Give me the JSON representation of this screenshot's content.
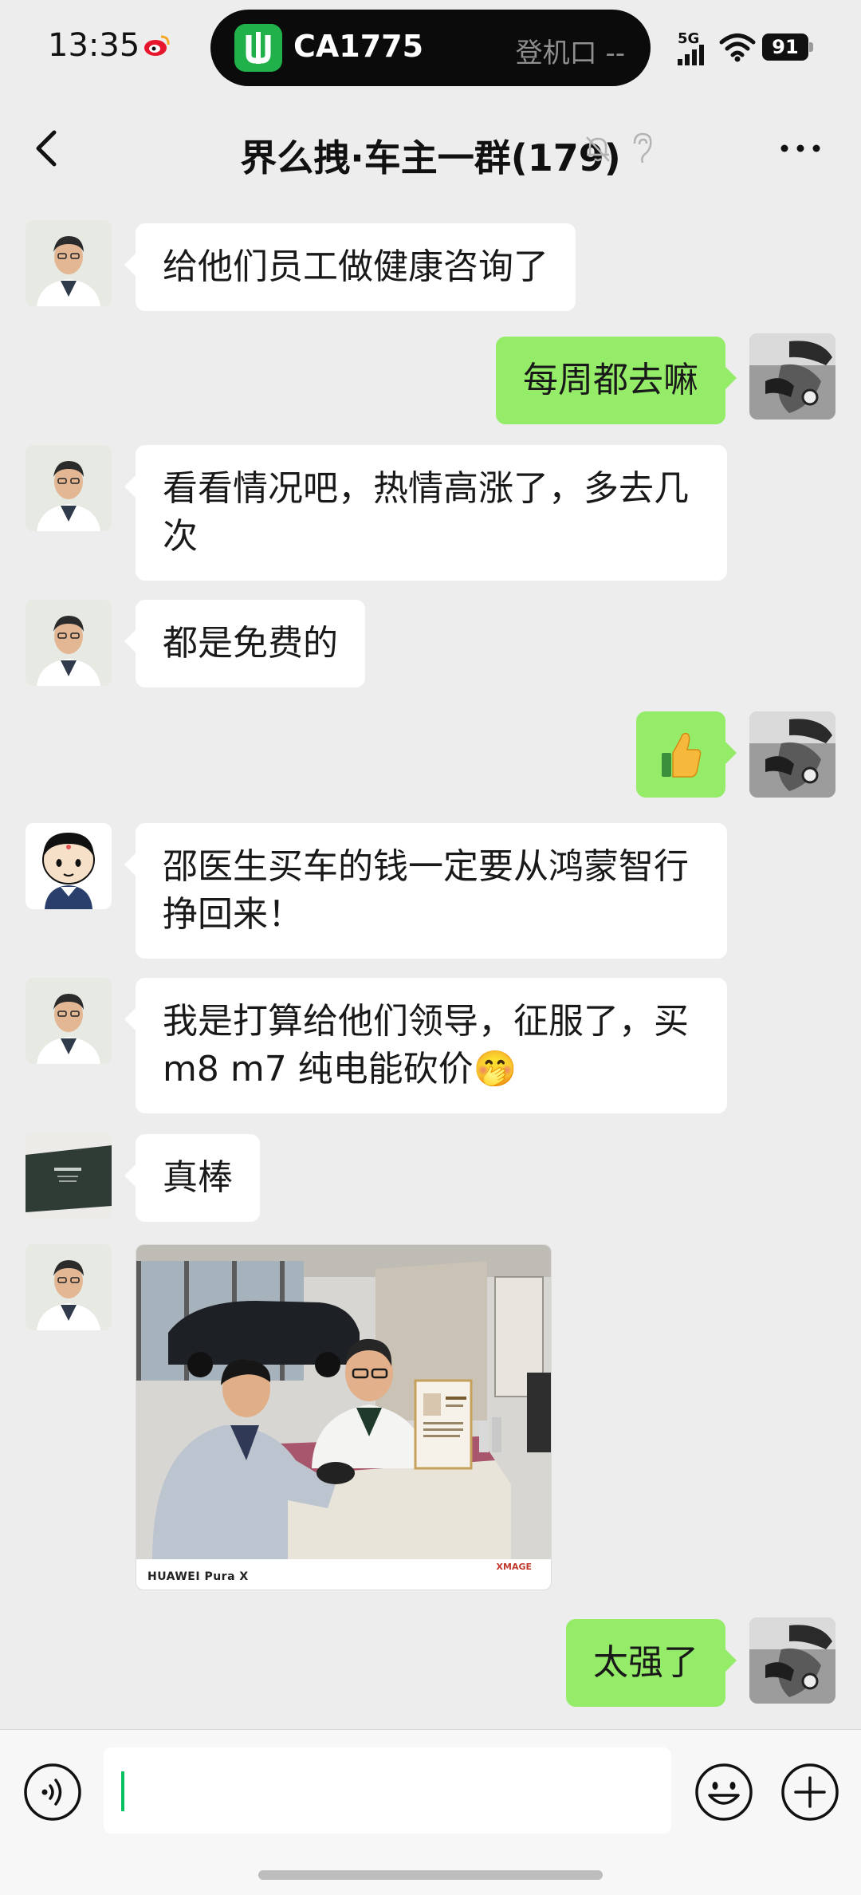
{
  "status_bar": {
    "time": "13:35",
    "flight": "CA1775",
    "gate": "登机口 --",
    "network": "5G",
    "battery": "91"
  },
  "header": {
    "title": "界么拽·车主一群(179)"
  },
  "messages": [
    {
      "side": "left",
      "sender": "doctor",
      "text": "给他们员工做健康咨询了"
    },
    {
      "side": "right",
      "sender": "me",
      "text": "每周都去嘛"
    },
    {
      "side": "left",
      "sender": "doctor",
      "text": "看看情况吧，热情高涨了，多去几次"
    },
    {
      "side": "left",
      "sender": "doctor",
      "text": "都是免费的"
    },
    {
      "side": "right",
      "sender": "me",
      "text": "👍"
    },
    {
      "side": "left",
      "sender": "cartoon",
      "text": "邵医生买车的钱一定要从鸿蒙智行挣回来！"
    },
    {
      "side": "left",
      "sender": "doctor",
      "text": "我是打算给他们领导，征服了，买m8 m7 纯电能砍价🤭"
    },
    {
      "side": "left",
      "sender": "member",
      "text": "真棒"
    },
    {
      "side": "left",
      "sender": "doctor",
      "type": "image",
      "caption": "HUAWEI Pura X",
      "brand": "XMAGE"
    },
    {
      "side": "right",
      "sender": "me",
      "text": "太强了"
    }
  ],
  "input": {
    "value": ""
  },
  "colors": {
    "background": "#EDEDED",
    "bubble_self": "#95EC69",
    "bubble_other": "#FFFFFF",
    "caret": "#07C160"
  }
}
